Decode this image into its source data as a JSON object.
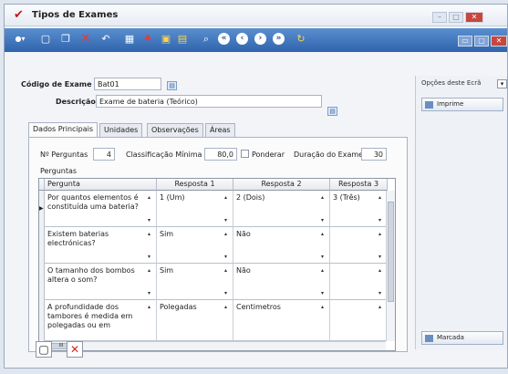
{
  "window": {
    "title": "Tipos de Exames"
  },
  "toolbar": {
    "icons": [
      "dot-icon",
      "new-icon",
      "copy-icon",
      "delete-icon",
      "undo-icon",
      "grid-icon",
      "users-icon",
      "print-icon",
      "chart-icon",
      "search-icon",
      "nav-first-icon",
      "nav-prev-icon",
      "nav-next-icon",
      "nav-last-icon",
      "refresh-icon"
    ]
  },
  "header": {
    "codigo_label": "Código de Exame",
    "codigo_value": "Bat01",
    "descricao_label": "Descrição",
    "descricao_value": "Exame de bateria (Teórico)"
  },
  "side": {
    "options_label": "Opções deste Ecrã",
    "imprime_label": "Imprime",
    "marcada_label": "Marcada"
  },
  "tabs": [
    "Dados Principais",
    "Unidades",
    "Observações",
    "Áreas"
  ],
  "main": {
    "n_perguntas_label": "Nº Perguntas",
    "n_perguntas_value": "4",
    "classificacao_label": "Classificação Mínima",
    "classificacao_value": "80,0",
    "ponderar_label": "Ponderar",
    "duracao_label": "Duração do Exame",
    "duracao_value": "30",
    "perguntas_label": "Perguntas"
  },
  "grid": {
    "columns": [
      "Pergunta",
      "Resposta 1",
      "Resposta 2",
      "Resposta 3"
    ],
    "rows": [
      [
        "Por quantos elementos é constituída uma bateria?",
        "1 (Um)",
        "2 (Dois)",
        "3 (Três)"
      ],
      [
        "Existem baterias electrónicas?",
        "Sim",
        "Não",
        ""
      ],
      [
        "O tamanho dos bombos altera o som?",
        "Sim",
        "Não",
        ""
      ],
      [
        "A profundidade dos tambores é medida em polegadas ou em",
        "Polegadas",
        "Centimetros",
        ""
      ]
    ],
    "hscroll_label": "III"
  }
}
